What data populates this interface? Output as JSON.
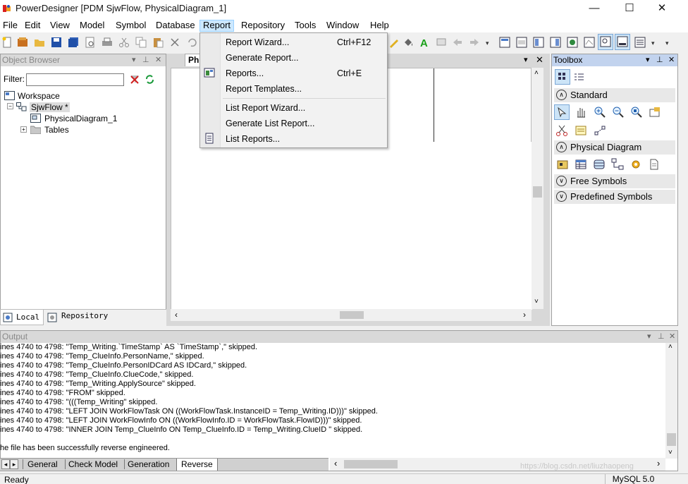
{
  "window": {
    "title": "PowerDesigner [PDM SjwFlow, PhysicalDiagram_1]",
    "minimize": "—",
    "maximize": "☐",
    "close": "✕"
  },
  "menu": {
    "items": [
      "File",
      "Edit",
      "View",
      "Model",
      "Symbol",
      "Database",
      "Report",
      "Repository",
      "Tools",
      "Window",
      "Help"
    ],
    "active": "Report"
  },
  "report_menu": {
    "items": [
      {
        "label": "Report Wizard...",
        "shortcut": "Ctrl+F12"
      },
      {
        "label": "Generate Report...",
        "shortcut": ""
      },
      {
        "label": "Reports...",
        "shortcut": "Ctrl+E"
      },
      {
        "label": "Report Templates...",
        "shortcut": ""
      },
      {
        "label": "List Report Wizard...",
        "shortcut": ""
      },
      {
        "label": "Generate List Report...",
        "shortcut": ""
      },
      {
        "label": "List Reports...",
        "shortcut": ""
      }
    ]
  },
  "object_browser": {
    "title": "Object Browser",
    "filter_label": "Filter:",
    "filter_value": "",
    "tree": {
      "workspace": "Workspace",
      "model": "SjwFlow *",
      "diagram": "PhysicalDiagram_1",
      "tables": "Tables"
    },
    "tabs": [
      "Local",
      "Repository"
    ]
  },
  "diagram": {
    "tab_label": "Ph"
  },
  "toolbox": {
    "title": "Toolbox",
    "sections": [
      "Standard",
      "Physical Diagram",
      "Free Symbols",
      "Predefined Symbols"
    ]
  },
  "output": {
    "title": "Output",
    "lines": [
      "ines 4740 to 4798:  \"Temp_Writing.`TimeStamp` AS `TimeStamp`,\" skipped.",
      "ines 4740 to 4798:  \"Temp_ClueInfo.PersonName,\" skipped.",
      "ines 4740 to 4798:  \"Temp_ClueInfo.PersonIDCard AS IDCard,\" skipped.",
      "ines 4740 to 4798:  \"Temp_ClueInfo.ClueCode,\" skipped.",
      "ines 4740 to 4798:  \"Temp_Writing.ApplySource\" skipped.",
      "ines 4740 to 4798:  \"FROM\" skipped.",
      "ines 4740 to 4798:  \"(((Temp_Writing\" skipped.",
      "ines 4740 to 4798:  \"LEFT JOIN WorkFlowTask ON ((WorkFlowTask.InstanceID = Temp_Writing.ID)))\" skipped.",
      "ines 4740 to 4798:  \"LEFT JOIN WorkFlowInfo ON ((WorkFlowInfo.ID = WorkFlowTask.FlowID)))\" skipped.",
      "ines 4740 to 4798:  \"INNER JOIN Temp_ClueInfo ON Temp_ClueInfo.ID = Temp_Writing.ClueID \" skipped.",
      "",
      "he file has been successfully reverse engineered."
    ],
    "tabs": [
      "General",
      "Check Model",
      "Generation",
      "Reverse"
    ],
    "active_tab": "Reverse"
  },
  "status": {
    "left": "Ready",
    "right": "MySQL 5.0",
    "watermark": "https://blog.csdn.net/liuzhaopeng"
  }
}
